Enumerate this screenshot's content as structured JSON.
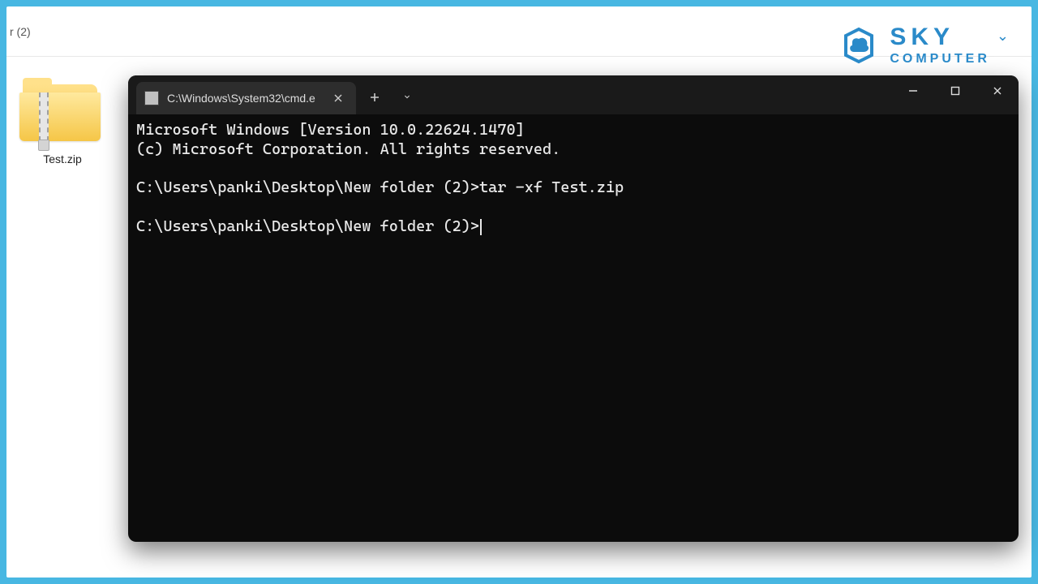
{
  "explorer": {
    "breadcrumb_fragment": "r (2)",
    "file_name": "Test.zip"
  },
  "logo": {
    "top": "SKY",
    "bottom": "COMPUTER"
  },
  "terminal": {
    "tab_title": "C:\\Windows\\System32\\cmd.e",
    "lines": {
      "version": "Microsoft Windows [Version 10.0.22624.1470]",
      "copyright": "(c) Microsoft Corporation. All rights reserved.",
      "prompt1_path": "C:\\Users\\panki\\Desktop\\New folder (2)>",
      "prompt1_cmd": "tar -xf Test.zip",
      "prompt2_path": "C:\\Users\\panki\\Desktop\\New folder (2)>"
    }
  }
}
